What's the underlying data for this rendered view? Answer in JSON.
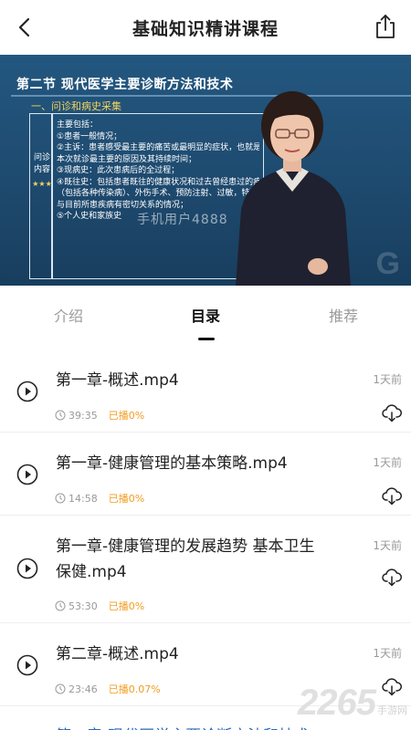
{
  "header": {
    "title": "基础知识精讲课程"
  },
  "video": {
    "slide_title": "第二节   现代医学主要诊断方法和技术",
    "slide_subtitle": "一、问诊和病史采集",
    "side_label": "问诊内容",
    "side_stars": "★★★",
    "slide_lines": [
      "主要包括：",
      "①患者一般情况；",
      "②主诉：患者感受最主要的痛苦或最明显的症状，也就是",
      "本次就诊最主要的原因及其持续时间；",
      "③现病史：此次患病后的全过程；",
      "④既往史：包括患者既往的健康状况和过去曾经患过的疾病",
      "（包括各种传染病）、外伤手术、预防注射、过敏，特别是",
      "与目前所患疾病有密切关系的情况；",
      "⑤个人史和家族史"
    ],
    "watermark": "手机用户4888"
  },
  "tabs": [
    {
      "label": "介绍",
      "active": false
    },
    {
      "label": "目录",
      "active": true
    },
    {
      "label": "推荐",
      "active": false
    }
  ],
  "items": [
    {
      "name": "第一章-概述.mp4",
      "when": "1天前",
      "duration": "39:35",
      "played": "已播0%"
    },
    {
      "name": "第一章-健康管理的基本策略.mp4",
      "when": "1天前",
      "duration": "14:58",
      "played": "已播0%"
    },
    {
      "name": "第一章-健康管理的发展趋势 基本卫生保健.mp4",
      "when": "1天前",
      "duration": "53:30",
      "played": "已播0%"
    },
    {
      "name": "第二章-概述.mp4",
      "when": "1天前",
      "duration": "23:46",
      "played": "已播0.07%"
    }
  ],
  "peek_item": "第二章-现代医学主要诊断方法和技术",
  "brand": {
    "number": "2265",
    "suffix": "手游网"
  }
}
